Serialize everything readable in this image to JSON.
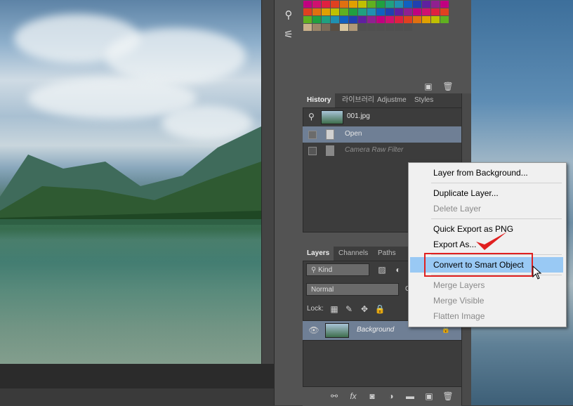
{
  "history_panel": {
    "tabs": [
      "History",
      "라이브러리",
      "Adjustme",
      "Styles"
    ],
    "snapshot_name": "001.jpg",
    "steps": [
      "Open",
      "Camera Raw Filter"
    ]
  },
  "layers_panel": {
    "tabs": [
      "Layers",
      "Channels",
      "Paths"
    ],
    "filter_kind": "Kind",
    "blend_mode": "Normal",
    "opacity_label": "O",
    "lock_label": "Lock:",
    "layer_name": "Background"
  },
  "context_menu": {
    "items": [
      "Layer from Background...",
      "Duplicate Layer...",
      "Delete Layer",
      "Quick Export as PNG",
      "Export As...",
      "Convert to Smart Object",
      "Merge Layers",
      "Merge Visible",
      "Flatten Image"
    ],
    "highlighted": "Convert to Smart Object",
    "disabled": [
      "Delete Layer",
      "Merge Layers",
      "Merge Visible",
      "Flatten Image"
    ]
  },
  "icons": {
    "brush_presets": "brush-icon",
    "tool_presets": "sliders-icon",
    "new_snapshot": "new-icon",
    "trash": "trash-icon",
    "visibility": "eye-icon",
    "lock": "lock-icon",
    "panel_menu": "menu-icon"
  },
  "colors": {
    "highlight": "#99c9f4",
    "annotation_red": "#e02020",
    "panel_bg": "#535353"
  }
}
